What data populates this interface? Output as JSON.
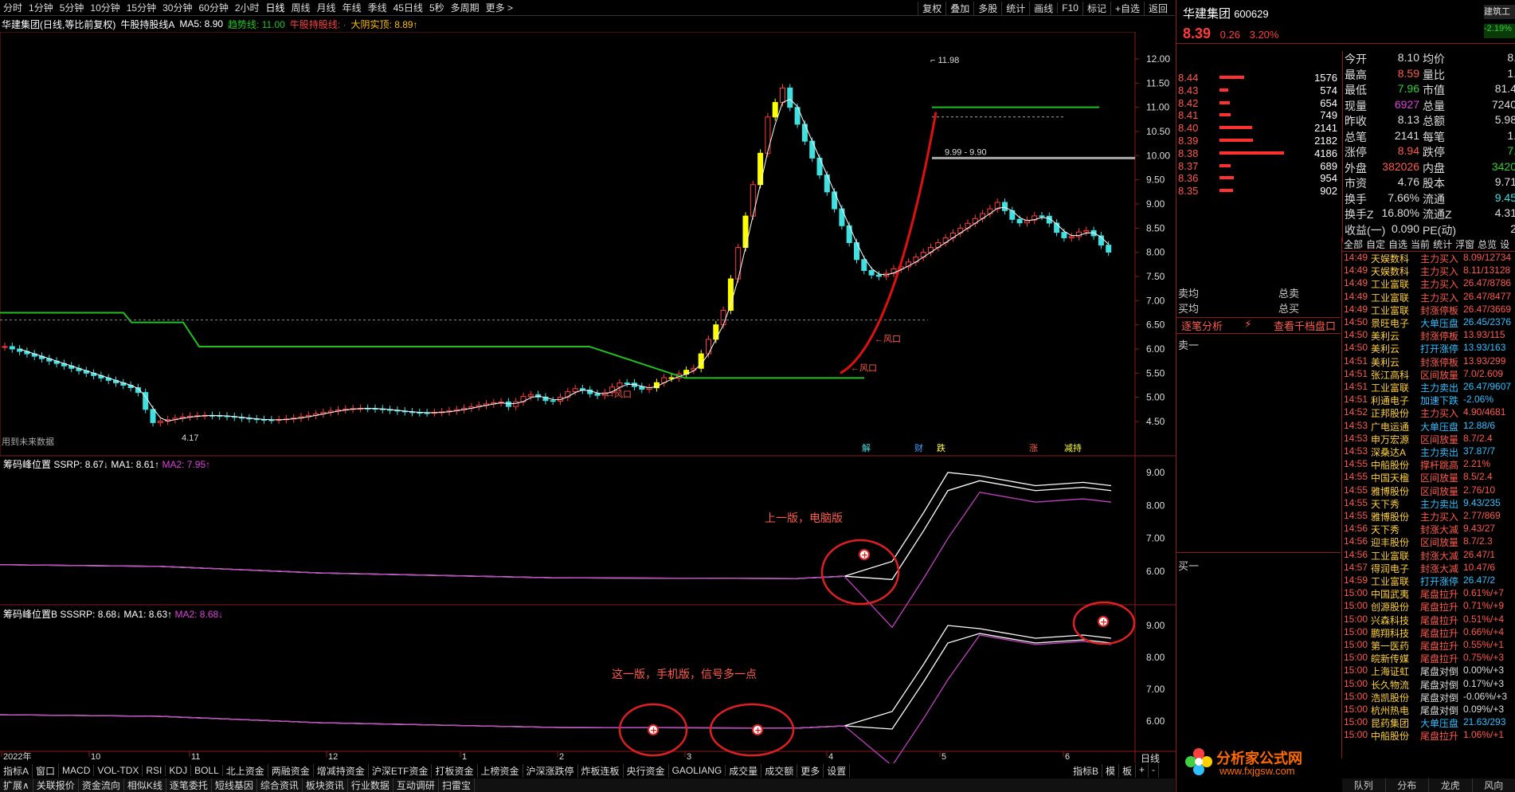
{
  "toolbar": {
    "timeframes": [
      "分时",
      "1分钟",
      "5分钟",
      "10分钟",
      "15分钟",
      "30分钟",
      "60分钟",
      "2小时",
      "日线",
      "周线",
      "月线",
      "年线",
      "季线",
      "45日线",
      "5秒",
      "多周期",
      "更多 >"
    ],
    "right_buttons": [
      "复权",
      "叠加",
      "多股",
      "统计",
      "画线",
      "F10",
      "标记",
      "+自选",
      "返回"
    ]
  },
  "info": {
    "stock_name": "华建集团(日线,等比前复权)",
    "indicator": "牛股持股线A",
    "ma5_label": "MA5: 8.90",
    "trend_label": "趋势线: 11.00",
    "bull_label": "牛股持股线: ·",
    "yin_label": "大阴实顶: 8.89↑"
  },
  "main_chart": {
    "price_ticks": [
      "12.00",
      "11.50",
      "11.00",
      "10.50",
      "10.00",
      "9.50",
      "9.00",
      "8.50",
      "8.00",
      "7.50",
      "7.00",
      "6.50",
      "6.00",
      "5.50",
      "5.00",
      "4.50"
    ],
    "high_label": "11.98",
    "low_label": "4.17",
    "range_label": "9.99 - 9.90",
    "wind_labels": [
      "风口",
      "风口",
      "风口"
    ],
    "future_note": "用到未来数据",
    "event_tags": [
      "解",
      "财",
      "跌",
      "涨",
      "减持"
    ]
  },
  "sub1": {
    "title": "筹码峰位置",
    "v1": "SSRP: 8.67↓",
    "v2": "MA1: 8.61↑",
    "v3": "MA2: 7.95↑",
    "ticks": [
      "9.00",
      "8.00",
      "7.00",
      "6.00"
    ],
    "annotation": "上一版，电脑版"
  },
  "sub2": {
    "title": "筹码峰位置B",
    "v1": "SSSRP: 8.68↓",
    "v2": "MA1: 8.63↑",
    "v3": "MA2: 8.68↓",
    "ticks": [
      "9.00",
      "8.00",
      "7.00",
      "6.00"
    ],
    "annotation": "这一版，手机版，信号多一点"
  },
  "date_axis": [
    "2022年",
    "10",
    "11",
    "12",
    "1",
    "2",
    "3",
    "4",
    "5",
    "6"
  ],
  "period_label": "日线",
  "bottom_tabs": [
    "指标A",
    "窗口",
    "MACD",
    "VOL-TDX",
    "RSI",
    "KDJ",
    "BOLL",
    "北上资金",
    "两融资金",
    "增减持资金",
    "沪深ETF资金",
    "打板资金",
    "上榜资金",
    "沪深涨跌停",
    "炸板连板",
    "央行资金",
    "GAOLIANG",
    "成交量",
    "成交额",
    "更多",
    "设置"
  ],
  "bottom_right": [
    "指标B",
    "模",
    "板",
    "+",
    "-"
  ],
  "bottom_tabs2": [
    "扩展∧",
    "关联报价",
    "资金流向",
    "相似K线",
    "逐笔委托",
    "短线基因",
    "综合资讯",
    "板块资讯",
    "行业数据",
    "互动调研",
    "扫雷宝"
  ],
  "quote": {
    "name": "华建集团",
    "code": "600629",
    "price": "8.39",
    "change": "0.26",
    "pct": "3.20%",
    "side_badge1": "建筑工",
    "side_badge2": "-2.19%",
    "rows": [
      {
        "l1": "今开",
        "v1": "8.10",
        "l2": "均价",
        "v2": "8."
      },
      {
        "l1": "最高",
        "v1": "8.59",
        "l2": "量比",
        "v2": "1."
      },
      {
        "l1": "最低",
        "v1": "7.96",
        "l2": "市值",
        "v2": "81.4"
      },
      {
        "l1": "现量",
        "v1": "6927",
        "l2": "总量",
        "v2": "7240"
      },
      {
        "l1": "昨收",
        "v1": "8.13",
        "l2": "总额",
        "v2": "5.98"
      },
      {
        "l1": "总笔",
        "v1": "2141",
        "l2": "每笔",
        "v2": "1."
      },
      {
        "l1": "涨停",
        "v1": "8.94",
        "l2": "跌停",
        "v2": "7."
      },
      {
        "l1": "外盘",
        "v1": "382026",
        "l2": "内盘",
        "v2": "3420"
      },
      {
        "l1": "市资",
        "v1": "4.76",
        "l2": "股本",
        "v2": "9.71"
      },
      {
        "l1": "换手",
        "v1": "7.66%",
        "l2": "流通",
        "v2": "9.45"
      },
      {
        "l1": "换手Z",
        "v1": "16.80%",
        "l2": "流通Z",
        "v2": "4.31"
      },
      {
        "l1": "收益(一)",
        "v1": "0.090",
        "l2": "PE(动)",
        "v2": "2"
      }
    ]
  },
  "depth": {
    "prices": [
      "8.44",
      "8.43",
      "8.42",
      "8.41",
      "8.40",
      "8.39",
      "8.38",
      "8.37",
      "8.36",
      "8.35"
    ],
    "vols": [
      "1576",
      "574",
      "654",
      "749",
      "2141",
      "2182",
      "4186",
      "689",
      "954",
      "902"
    ],
    "bars": [
      0.34,
      0.12,
      0.14,
      0.16,
      0.46,
      0.47,
      0.9,
      0.15,
      0.2,
      0.19
    ]
  },
  "orders": {
    "sell_avg": "卖均",
    "buy_avg": "买均",
    "total_sell": "总卖",
    "total_buy": "总买",
    "analysis": "逐笔分析",
    "thousand": "查看千档盘口",
    "sell1": "卖一",
    "buy1": "买一"
  },
  "monitor_tabs": [
    "全部",
    "自定",
    "自选",
    "当前",
    "统计",
    "浮窗",
    "总览",
    "设"
  ],
  "monitor": [
    [
      "14:49",
      "天娱数科",
      "主力买入",
      "8.09/12734"
    ],
    [
      "14:49",
      "天娱数科",
      "主力买入",
      "8.11/13128"
    ],
    [
      "14:49",
      "工业富联",
      "主力买入",
      "26.47/8786"
    ],
    [
      "14:49",
      "工业富联",
      "主力买入",
      "26.47/8477"
    ],
    [
      "14:49",
      "工业富联",
      "封涨停板",
      "26.47/3669"
    ],
    [
      "14:50",
      "景旺电子",
      "大单压盘",
      "26.45/2376"
    ],
    [
      "14:50",
      "美利云",
      "封涨停板",
      "13.93/115"
    ],
    [
      "14:50",
      "美利云",
      "打开涨停",
      "13.93/163"
    ],
    [
      "14:51",
      "美利云",
      "封涨停板",
      "13.93/299"
    ],
    [
      "14:51",
      "张江高科",
      "区间放量",
      "7.0/2.609"
    ],
    [
      "14:51",
      "工业富联",
      "主力卖出",
      "26.47/9607"
    ],
    [
      "14:51",
      "利通电子",
      "加速下跌",
      "-2.06%"
    ],
    [
      "14:52",
      "正邦股份",
      "主力买入",
      "4.90/4681"
    ],
    [
      "14:53",
      "广电运通",
      "大单压盘",
      "12.88/6"
    ],
    [
      "14:53",
      "申万宏源",
      "区间放量",
      "8.7/2.4"
    ],
    [
      "14:53",
      "深桑达A",
      "主力卖出",
      "37.87/7"
    ],
    [
      "14:55",
      "中船股份",
      "撑杆跳高",
      "2.21%"
    ],
    [
      "14:55",
      "中国天楹",
      "区间放量",
      "8.5/2.4"
    ],
    [
      "14:55",
      "雅博股份",
      "区间放量",
      "2.76/10"
    ],
    [
      "14:55",
      "天下秀",
      "主力卖出",
      "9.43/235"
    ],
    [
      "14:55",
      "雅博股份",
      "主力买入",
      "2.77/869"
    ],
    [
      "14:56",
      "天下秀",
      "封涨大减",
      "9.43/27"
    ],
    [
      "14:56",
      "迎丰股份",
      "区间放量",
      "8.7/2.3"
    ],
    [
      "14:56",
      "工业富联",
      "封涨大减",
      "26.47/1"
    ],
    [
      "14:57",
      "得润电子",
      "封涨大减",
      "10.47/6"
    ],
    [
      "14:59",
      "工业富联",
      "打开涨停",
      "26.47/2"
    ],
    [
      "15:00",
      "中国武夷",
      "尾盘拉升",
      "0.61%/+7"
    ],
    [
      "15:00",
      "创源股份",
      "尾盘拉升",
      "0.71%/+9"
    ],
    [
      "15:00",
      "兴森科技",
      "尾盘拉升",
      "0.51%/+4"
    ],
    [
      "15:00",
      "鹏翔科技",
      "尾盘拉升",
      "0.66%/+4"
    ],
    [
      "15:00",
      "第一医药",
      "尾盘拉升",
      "0.55%/+1"
    ],
    [
      "15:00",
      "皖新传媒",
      "尾盘拉升",
      "0.75%/+3"
    ],
    [
      "15:00",
      "上海证虹",
      "尾盘对倒",
      "0.00%/+3"
    ],
    [
      "15:00",
      "长久物流",
      "尾盘对倒",
      "0.17%/+3"
    ],
    [
      "15:00",
      "浩凯股份",
      "尾盘对倒",
      "-0.06%/+3"
    ],
    [
      "15:00",
      "杭州热电",
      "尾盘对倒",
      "0.09%/+3"
    ],
    [
      "15:00",
      "昆药集团",
      "大单压盘",
      "21.63/293"
    ],
    [
      "15:00",
      "中船股份",
      "尾盘拉升",
      "1.06%/+1"
    ]
  ],
  "right_bottom": [
    "队列",
    "分布",
    "龙虎",
    "风向"
  ],
  "watermark": {
    "title": "分析家公式网",
    "url": "www.fxjgsw.com"
  },
  "colors": {
    "up": "#ff3c3c",
    "down": "#40e0e0",
    "trend": "#20c020",
    "yellow": "#ffff00",
    "grid": "#8c1a1a"
  }
}
